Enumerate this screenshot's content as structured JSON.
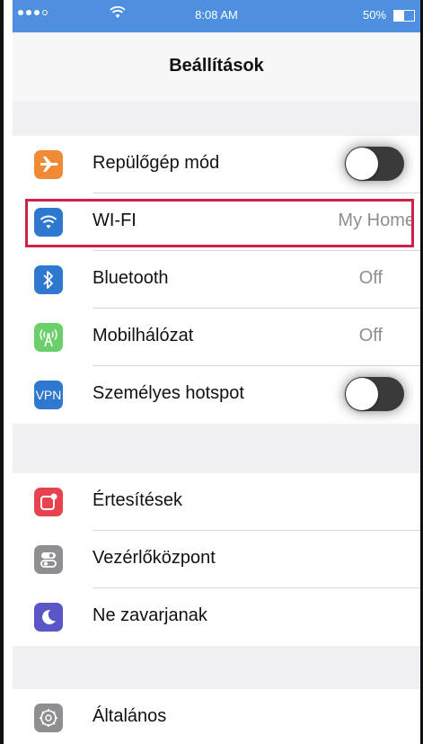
{
  "statusbar": {
    "time": "8:08 AM",
    "battery": "50%"
  },
  "navbar": {
    "title": "Beállítások"
  },
  "colors": {
    "airplane": "#f08a34",
    "wifi": "#2f78d0",
    "bluetooth": "#2f78d0",
    "cellular": "#6bd06b",
    "vpn": "#2f78d0",
    "notifications": "#e8424e",
    "control": "#8e8e93",
    "dnd": "#5a56c8",
    "general": "#8e8e93",
    "highlight": "#d11f45"
  },
  "group1": {
    "airplane": {
      "label": "Repülőgép mód",
      "icon": "airplane-icon"
    },
    "wifi": {
      "label": "WI-FI",
      "value": "My Home",
      "icon": "wifi-icon"
    },
    "bluetooth": {
      "label": "Bluetooth",
      "value": "Off",
      "icon": "bluetooth-icon"
    },
    "cellular": {
      "label": "Mobilhálózat",
      "value": "Off",
      "icon": "cellular-icon"
    },
    "hotspot": {
      "label": "Személyes hotspot",
      "icon_text": "VPN"
    }
  },
  "group2": {
    "notifications": {
      "label": "Értesítések",
      "icon": "notifications-icon"
    },
    "control": {
      "label": "Vezérlőközpont",
      "icon": "control-center-icon"
    },
    "dnd": {
      "label": "Ne zavarjanak",
      "icon": "moon-icon"
    }
  },
  "group3": {
    "general": {
      "label": "Általános",
      "icon": "gear-icon"
    }
  }
}
